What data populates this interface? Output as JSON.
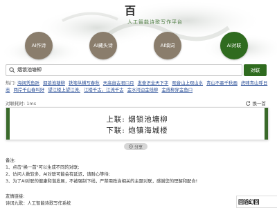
{
  "header": {
    "logo_char": "百",
    "tagline": "人工智能诗歌写作平台"
  },
  "modes": [
    {
      "label": "AI作诗",
      "active": false
    },
    {
      "label": "AI藏头诗",
      "active": false
    },
    {
      "label": "AI填词",
      "active": false
    },
    {
      "label": "AI对联",
      "active": true
    }
  ],
  "colors": {
    "mode_inactive": "#8a7d6c",
    "mode_active": "#2f6b1f",
    "accent": "#2f6b1f",
    "link": "#2a4f98"
  },
  "search": {
    "value": "烟锁池塘柳",
    "button": "对联"
  },
  "hot": {
    "label": "热门:",
    "links": [
      "海阔凭鱼跃",
      "烟锁池塘柳",
      "铁笔纵横写春秋",
      "天高自古君口月",
      "发奋识全天下字",
      "观音山上观山水",
      "青山不墨千秋画",
      "虎啸青山呼日志",
      "两岸千山春叫好",
      "望江楼上望江流,",
      "江楼千古，江流千古",
      "金水河边金线柳",
      "金线柳穿金鱼口"
    ]
  },
  "meta": {
    "time": "对联耗时: 1ms",
    "change": "换一首"
  },
  "poem": {
    "line1": "上联: 烟锁池塘柳",
    "line2": "下联: 炮镇海城楼"
  },
  "share": "分享",
  "notes": {
    "title": "备注:",
    "items": [
      "1、点击\"换一首\"可以生成不同的对联;",
      "2、访问人数较多，AI对联可能会有延迟，请耐心等待;",
      "3、为了AI对联的健康和谐发展，不被强制下线，严禁用政治相关的主题对联，感谢您的理解和配合!"
    ]
  },
  "friends": {
    "title": "友情链接:",
    "line": "诗词九歌：人工智能诗歌写作系统"
  },
  "qr_text": "回浴幻回"
}
